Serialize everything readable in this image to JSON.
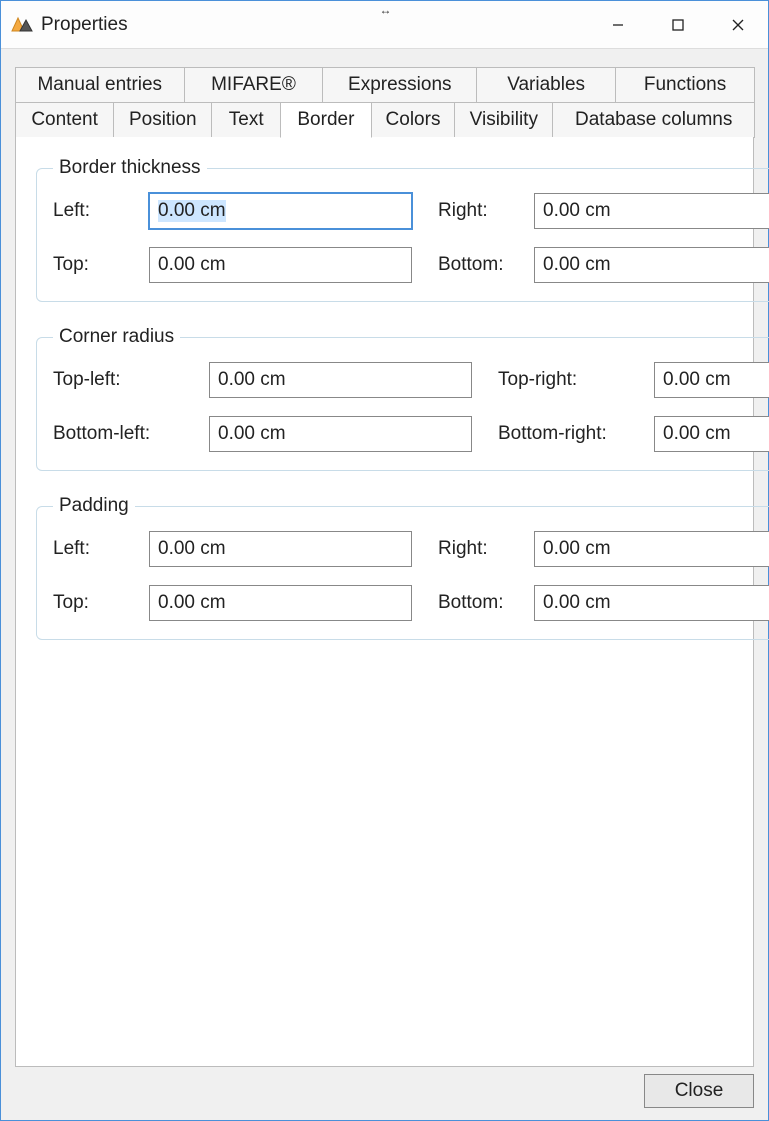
{
  "window": {
    "title": "Properties"
  },
  "tabs_row1": [
    {
      "label": "Manual entries"
    },
    {
      "label": "MIFARE®"
    },
    {
      "label": "Expressions"
    },
    {
      "label": "Variables"
    },
    {
      "label": "Functions"
    }
  ],
  "tabs_row2": [
    {
      "label": "Content"
    },
    {
      "label": "Position"
    },
    {
      "label": "Text"
    },
    {
      "label": "Border",
      "active": true
    },
    {
      "label": "Colors"
    },
    {
      "label": "Visibility"
    },
    {
      "label": "Database columns"
    }
  ],
  "groups": {
    "border_thickness": {
      "legend": "Border thickness",
      "left": {
        "label": "Left:",
        "value": "0.00 cm",
        "selected": true
      },
      "right": {
        "label": "Right:",
        "value": "0.00 cm"
      },
      "top": {
        "label": "Top:",
        "value": "0.00 cm"
      },
      "bottom": {
        "label": "Bottom:",
        "value": "0.00 cm"
      }
    },
    "corner_radius": {
      "legend": "Corner radius",
      "top_left": {
        "label": "Top-left:",
        "value": "0.00 cm"
      },
      "top_right": {
        "label": "Top-right:",
        "value": "0.00 cm"
      },
      "bottom_left": {
        "label": "Bottom-left:",
        "value": "0.00 cm"
      },
      "bottom_right": {
        "label": "Bottom-right:",
        "value": "0.00 cm"
      }
    },
    "padding": {
      "legend": "Padding",
      "left": {
        "label": "Left:",
        "value": "0.00 cm"
      },
      "right": {
        "label": "Right:",
        "value": "0.00 cm"
      },
      "top": {
        "label": "Top:",
        "value": "0.00 cm"
      },
      "bottom": {
        "label": "Bottom:",
        "value": "0.00 cm"
      }
    }
  },
  "buttons": {
    "close": "Close"
  }
}
